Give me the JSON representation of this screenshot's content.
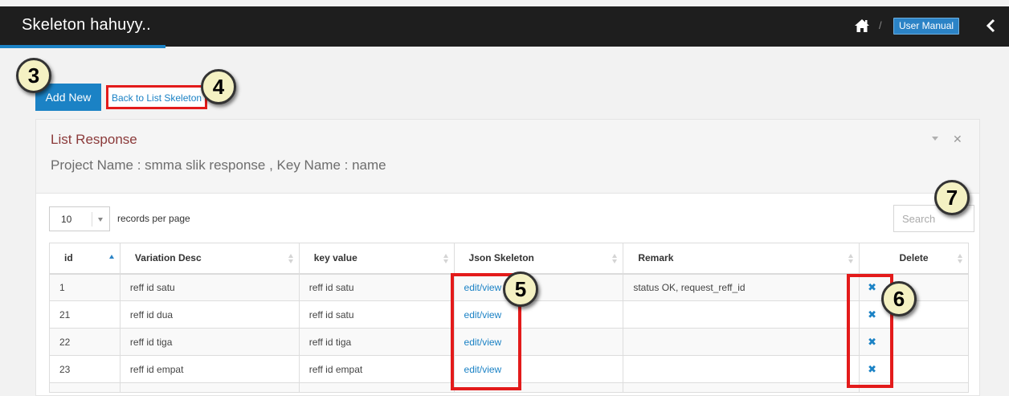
{
  "header": {
    "app_title": "Skeleton hahuyy..",
    "breadcrumb_separator": "/",
    "user_manual_label": "User Manual"
  },
  "toolbar": {
    "add_new_label": "Add New",
    "back_link_label": "Back to List Skeleton"
  },
  "panel": {
    "title": "List Response",
    "subtitle": "Project Name : smma slik response , Key Name : name"
  },
  "table_controls": {
    "page_length": "10",
    "page_length_label": "records per page",
    "search_placeholder": "Search"
  },
  "table": {
    "columns": [
      "id",
      "Variation Desc",
      "key value",
      "Json Skeleton",
      "Remark",
      "Delete"
    ],
    "rows": [
      {
        "id": "1",
        "variation_desc": "reff id satu",
        "key_value": "reff id satu",
        "json_skeleton": "edit/view",
        "remark": "status OK, request_reff_id",
        "delete": "✖"
      },
      {
        "id": "21",
        "variation_desc": "reff id dua",
        "key_value": "reff id satu",
        "json_skeleton": "edit/view",
        "remark": "",
        "delete": "✖"
      },
      {
        "id": "22",
        "variation_desc": "reff id tiga",
        "key_value": "reff id tiga",
        "json_skeleton": "edit/view",
        "remark": "",
        "delete": "✖"
      },
      {
        "id": "23",
        "variation_desc": "reff id empat",
        "key_value": "reff id empat",
        "json_skeleton": "edit/view",
        "remark": "",
        "delete": "✖"
      }
    ]
  },
  "annotations": {
    "badges": [
      "3",
      "4",
      "5",
      "6",
      "7"
    ],
    "highlight_color": "#e31b1b",
    "badge_color": "#f4f1c3"
  },
  "colors": {
    "accent": "#1b82c5",
    "topbar": "#1e1e1e",
    "panel_title": "#8b3a3a"
  }
}
